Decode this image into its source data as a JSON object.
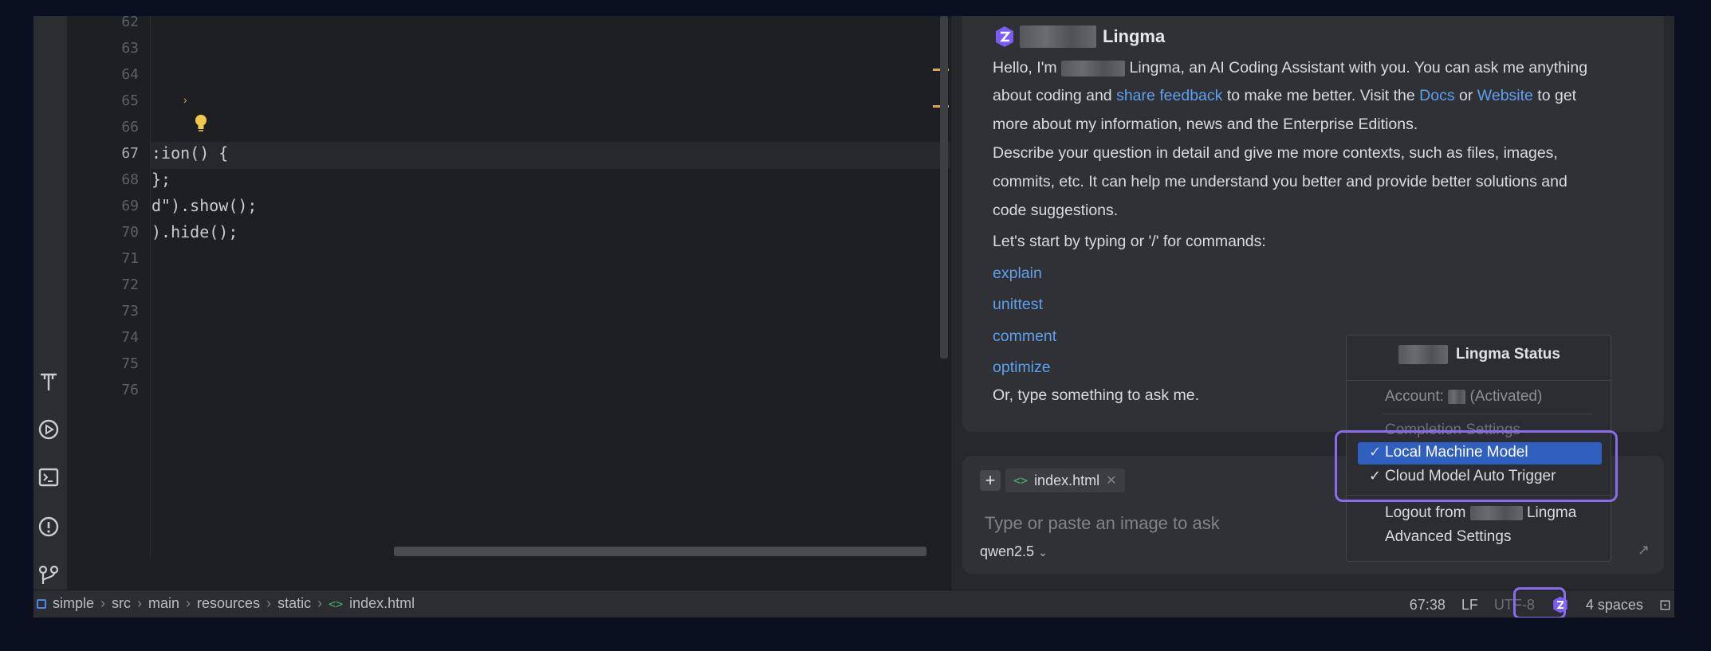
{
  "editor": {
    "line_numbers": [
      "62",
      "63",
      "64",
      "65",
      "66",
      "67",
      "68",
      "69",
      "70",
      "71",
      "72",
      "73",
      "74",
      "75",
      "76"
    ],
    "active_line": "67",
    "code_lines": [
      {
        "line": "67",
        "text": ":ion() {"
      },
      {
        "line": "68",
        "text": "};"
      },
      {
        "line": "69",
        "text": "d\").show();"
      },
      {
        "line": "70",
        "text": ").hide();"
      }
    ]
  },
  "activity_icons": [
    "font-icon",
    "run-icon",
    "terminal-icon",
    "problems-icon",
    "git-icon"
  ],
  "chat": {
    "title": "Lingma",
    "intro": {
      "hello": "Hello, I'm",
      "name": "Lingma, an AI Coding Assistant with you. You can ask me anything",
      "line2_pre": "about coding and ",
      "share_feedback": "share feedback",
      "line2_mid": " to make me better. Visit the ",
      "docs": "Docs",
      "or": " or ",
      "website": "Website",
      "line2_post": " to get",
      "line3": "more about my information, news and the Enterprise Editions.",
      "line4": "Describe your question in detail and give me more contexts, such as files, images,",
      "line5": "commits, etc. It can help me understand you better and provide better solutions and",
      "line6": "code suggestions.",
      "line7": "Let's start by typing or '/' for commands:"
    },
    "commands": [
      "explain",
      "unittest",
      "comment",
      "optimize"
    ],
    "footer": "Or, type something to ask me.",
    "input": {
      "file_chip": "index.html",
      "placeholder": "Type or paste an image to ask",
      "model": "qwen2.5"
    }
  },
  "status_popup": {
    "title": "Lingma Status",
    "account_label": "Account:",
    "account_status": "(Activated)",
    "completion_settings": "Completion Settings",
    "local_model": "Local Machine Model",
    "cloud_trigger": "Cloud Model Auto Trigger",
    "logout_pre": "Logout from",
    "logout_post": "Lingma",
    "advanced": "Advanced Settings"
  },
  "statusbar": {
    "breadcrumbs": [
      "simple",
      "src",
      "main",
      "resources",
      "static",
      "index.html"
    ],
    "position": "67:38",
    "line_sep": "LF",
    "encoding": "UTF-8",
    "indent": "4 spaces"
  },
  "colors": {
    "accent_link": "#5ea0ef",
    "highlight_ring": "#8a6cf0",
    "selection": "#2f5fbf"
  }
}
